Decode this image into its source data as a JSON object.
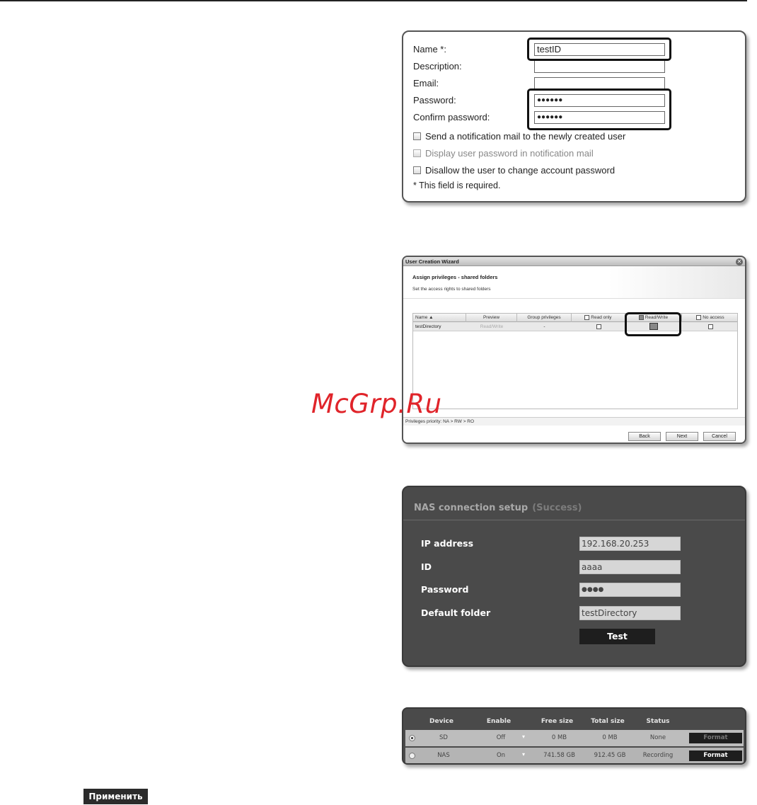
{
  "form": {
    "name_label": "Name *:",
    "name_value": "testID",
    "description_label": "Description:",
    "description_value": "",
    "email_label": "Email:",
    "email_value": "",
    "password_label": "Password:",
    "password_value": "●●●●●●",
    "confirm_label": "Confirm password:",
    "confirm_value": "●●●●●●",
    "check_notify": "Send a notification mail to the newly created user",
    "check_display_pw": "Display user password in notification mail",
    "check_disallow": "Disallow the user to change account password",
    "required_note": "* This field is required."
  },
  "wizard": {
    "title": "User Creation Wizard",
    "close_icon": "close-icon",
    "heading": "Assign privileges - shared folders",
    "subheading": "Set the access rights to shared folders",
    "columns": {
      "name": "Name ▲",
      "preview": "Preview",
      "group": "Group privileges",
      "read_only": "Read only",
      "read_write": "Read/Write",
      "no_access": "No access"
    },
    "row": {
      "name": "testDirectory",
      "preview": "Read/Write",
      "group": "-",
      "read_only_checked": false,
      "read_write_checked": true,
      "no_access_checked": false
    },
    "priority_note": "Privileges priority: NA > RW > RO",
    "back_label": "Back",
    "next_label": "Next",
    "cancel_label": "Cancel"
  },
  "watermark": "McGrp.Ru",
  "nas": {
    "title": "NAS connection setup",
    "status": "(Success)",
    "ip_label": "IP address",
    "ip_value": "192.168.20.253",
    "id_label": "ID",
    "id_value": "aaaa",
    "password_label": "Password",
    "password_value": "●●●●",
    "folder_label": "Default folder",
    "folder_value": "testDirectory",
    "test_label": "Test"
  },
  "storage": {
    "headers": [
      "Device",
      "Enable",
      "Free size",
      "Total size",
      "Status"
    ],
    "rows": [
      {
        "device": "SD",
        "enable": "Off",
        "free": "0 MB",
        "total": "0 MB",
        "status": "None",
        "format": "Format",
        "selected": true
      },
      {
        "device": "NAS",
        "enable": "On",
        "free": "741.58 GB",
        "total": "912.45 GB",
        "status": "Recording",
        "format": "Format",
        "selected": false
      }
    ]
  },
  "apply_label": "Применить"
}
